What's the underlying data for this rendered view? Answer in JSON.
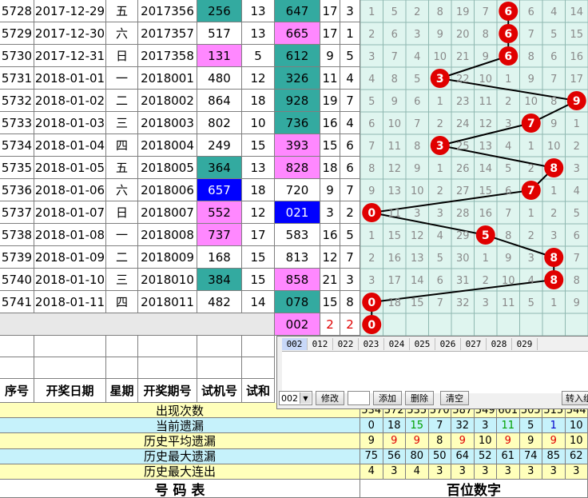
{
  "rows": [
    {
      "seq": "5728",
      "date": "2017-12-29",
      "weekday": "五",
      "issue": "2017356",
      "trial": "256",
      "trial_hl": "g",
      "sum": "13",
      "num": "647",
      "num_hl": "g",
      "span1": "17",
      "span2": "3",
      "cells": [
        "1",
        "5",
        "2",
        "8",
        "19",
        "7",
        "6",
        "6",
        "4",
        "14"
      ],
      "ball": 6
    },
    {
      "seq": "5729",
      "date": "2017-12-30",
      "weekday": "六",
      "issue": "2017357",
      "trial": "517",
      "trial_hl": "",
      "sum": "13",
      "num": "665",
      "num_hl": "m",
      "span1": "17",
      "span2": "1",
      "cells": [
        "2",
        "6",
        "3",
        "9",
        "20",
        "8",
        "6",
        "7",
        "5",
        "15"
      ],
      "ball": 6
    },
    {
      "seq": "5730",
      "date": "2017-12-31",
      "weekday": "日",
      "issue": "2017358",
      "trial": "131",
      "trial_hl": "m",
      "sum": "5",
      "num": "612",
      "num_hl": "g",
      "span1": "9",
      "span2": "5",
      "cells": [
        "3",
        "7",
        "4",
        "10",
        "21",
        "9",
        "6",
        "8",
        "6",
        "16"
      ],
      "ball": 6
    },
    {
      "seq": "5731",
      "date": "2018-01-01",
      "weekday": "一",
      "issue": "2018001",
      "trial": "480",
      "trial_hl": "",
      "sum": "12",
      "num": "326",
      "num_hl": "g",
      "span1": "11",
      "span2": "4",
      "cells": [
        "4",
        "8",
        "5",
        "3",
        "22",
        "10",
        "1",
        "9",
        "7",
        "17"
      ],
      "ball": 3
    },
    {
      "seq": "5732",
      "date": "2018-01-02",
      "weekday": "二",
      "issue": "2018002",
      "trial": "864",
      "trial_hl": "",
      "sum": "18",
      "num": "928",
      "num_hl": "g",
      "span1": "19",
      "span2": "7",
      "cells": [
        "5",
        "9",
        "6",
        "1",
        "23",
        "11",
        "2",
        "10",
        "8",
        "9"
      ],
      "ball": 9
    },
    {
      "seq": "5733",
      "date": "2018-01-03",
      "weekday": "三",
      "issue": "2018003",
      "trial": "802",
      "trial_hl": "",
      "sum": "10",
      "num": "736",
      "num_hl": "g",
      "span1": "16",
      "span2": "4",
      "cells": [
        "6",
        "10",
        "7",
        "2",
        "24",
        "12",
        "3",
        "7",
        "9",
        "1"
      ],
      "ball": 7
    },
    {
      "seq": "5734",
      "date": "2018-01-04",
      "weekday": "四",
      "issue": "2018004",
      "trial": "249",
      "trial_hl": "",
      "sum": "15",
      "num": "393",
      "num_hl": "m",
      "span1": "15",
      "span2": "6",
      "cells": [
        "7",
        "11",
        "8",
        "3",
        "25",
        "13",
        "4",
        "1",
        "10",
        "2"
      ],
      "ball": 3
    },
    {
      "seq": "5735",
      "date": "2018-01-05",
      "weekday": "五",
      "issue": "2018005",
      "trial": "364",
      "trial_hl": "g",
      "sum": "13",
      "num": "828",
      "num_hl": "m",
      "span1": "18",
      "span2": "6",
      "cells": [
        "8",
        "12",
        "9",
        "1",
        "26",
        "14",
        "5",
        "2",
        "8",
        "3"
      ],
      "ball": 8
    },
    {
      "seq": "5736",
      "date": "2018-01-06",
      "weekday": "六",
      "issue": "2018006",
      "trial": "657",
      "trial_hl": "b",
      "sum": "18",
      "num": "720",
      "num_hl": "",
      "span1": "9",
      "span2": "7",
      "cells": [
        "9",
        "13",
        "10",
        "2",
        "27",
        "15",
        "6",
        "7",
        "1",
        "4"
      ],
      "ball": 7
    },
    {
      "seq": "5737",
      "date": "2018-01-07",
      "weekday": "日",
      "issue": "2018007",
      "trial": "552",
      "trial_hl": "m",
      "sum": "12",
      "num": "021",
      "num_hl": "b",
      "span1": "3",
      "span2": "2",
      "cells": [
        "0",
        "11",
        "3",
        "3",
        "28",
        "16",
        "7",
        "1",
        "2",
        "5"
      ],
      "ball": 0
    },
    {
      "seq": "5738",
      "date": "2018-01-08",
      "weekday": "一",
      "issue": "2018008",
      "trial": "737",
      "trial_hl": "m",
      "sum": "17",
      "num": "583",
      "num_hl": "",
      "span1": "16",
      "span2": "5",
      "cells": [
        "1",
        "15",
        "12",
        "4",
        "29",
        "5",
        "8",
        "2",
        "3",
        "6"
      ],
      "ball": 5
    },
    {
      "seq": "5739",
      "date": "2018-01-09",
      "weekday": "二",
      "issue": "2018009",
      "trial": "168",
      "trial_hl": "",
      "sum": "15",
      "num": "813",
      "num_hl": "",
      "span1": "12",
      "span2": "7",
      "cells": [
        "2",
        "16",
        "13",
        "5",
        "30",
        "1",
        "9",
        "3",
        "8",
        "7"
      ],
      "ball": 8
    },
    {
      "seq": "5740",
      "date": "2018-01-10",
      "weekday": "三",
      "issue": "2018010",
      "trial": "384",
      "trial_hl": "g",
      "sum": "15",
      "num": "858",
      "num_hl": "m",
      "span1": "21",
      "span2": "3",
      "cells": [
        "3",
        "17",
        "14",
        "6",
        "31",
        "2",
        "10",
        "4",
        "8",
        "8"
      ],
      "ball": 8
    },
    {
      "seq": "5741",
      "date": "2018-01-11",
      "weekday": "四",
      "issue": "2018011",
      "trial": "482",
      "trial_hl": "",
      "sum": "14",
      "num": "078",
      "num_hl": "g",
      "span1": "15",
      "span2": "8",
      "cells": [
        "0",
        "18",
        "15",
        "7",
        "32",
        "3",
        "11",
        "5",
        "1",
        "9"
      ],
      "ball": 0
    }
  ],
  "pending": {
    "num": "002",
    "span1": "2",
    "span2": "2",
    "ball": 0
  },
  "headers": {
    "seq": "序号",
    "date": "开奖日期",
    "weekday": "星期",
    "issue": "开奖期号",
    "trial": "试机号",
    "trial_sum": "试和"
  },
  "stats": [
    {
      "label": "出现次数",
      "values": [
        "534",
        "572",
        "535",
        "570",
        "587",
        "549",
        "601",
        "505",
        "515",
        "544"
      ]
    },
    {
      "label": "当前遗漏",
      "values": [
        "0",
        "18",
        "15",
        "7",
        "32",
        "3",
        "11",
        "5",
        "1",
        "10"
      ]
    },
    {
      "label": "历史平均遗漏",
      "values": [
        "9",
        "9",
        "9",
        "8",
        "9",
        "10",
        "9",
        "9",
        "9",
        "10"
      ]
    },
    {
      "label": "历史最大遗漏",
      "values": [
        "75",
        "56",
        "80",
        "50",
        "64",
        "52",
        "61",
        "74",
        "85",
        "62"
      ]
    },
    {
      "label": "历史最大连出",
      "values": [
        "4",
        "3",
        "4",
        "3",
        "3",
        "3",
        "3",
        "3",
        "3",
        "3"
      ]
    }
  ],
  "stat_value_colors": [
    [],
    [
      "#000",
      "#000",
      "#00a000",
      "#000",
      "#000",
      "#000",
      "#00a000",
      "#000",
      "#0000cc",
      "#000"
    ],
    [
      "#000",
      "#e00000",
      "#e00000",
      "#000",
      "#e00000",
      "#000",
      "#e00000",
      "#000",
      "#e00000",
      "#000"
    ],
    [],
    []
  ],
  "footer": {
    "left": "号  码  表",
    "right": "百位数字"
  },
  "panel": {
    "tabs": [
      "002",
      "012",
      "022",
      "023",
      "024",
      "025",
      "026",
      "027",
      "028",
      "029"
    ],
    "active_tab": "002",
    "select_value": "002",
    "modify_label": "修改",
    "add_label": "添加",
    "delete_label": "删除",
    "clear_label": "清空",
    "import_label": "转入组"
  },
  "colors": {
    "grid_bg": "#dff5ef",
    "green": "#33aaa0",
    "magenta": "#ff88ff",
    "blue": "#0000ff",
    "ball": "#e00000",
    "stat_bg_yellow": "#ffffbb",
    "stat_bg_cyan": "#c6f2fb"
  }
}
